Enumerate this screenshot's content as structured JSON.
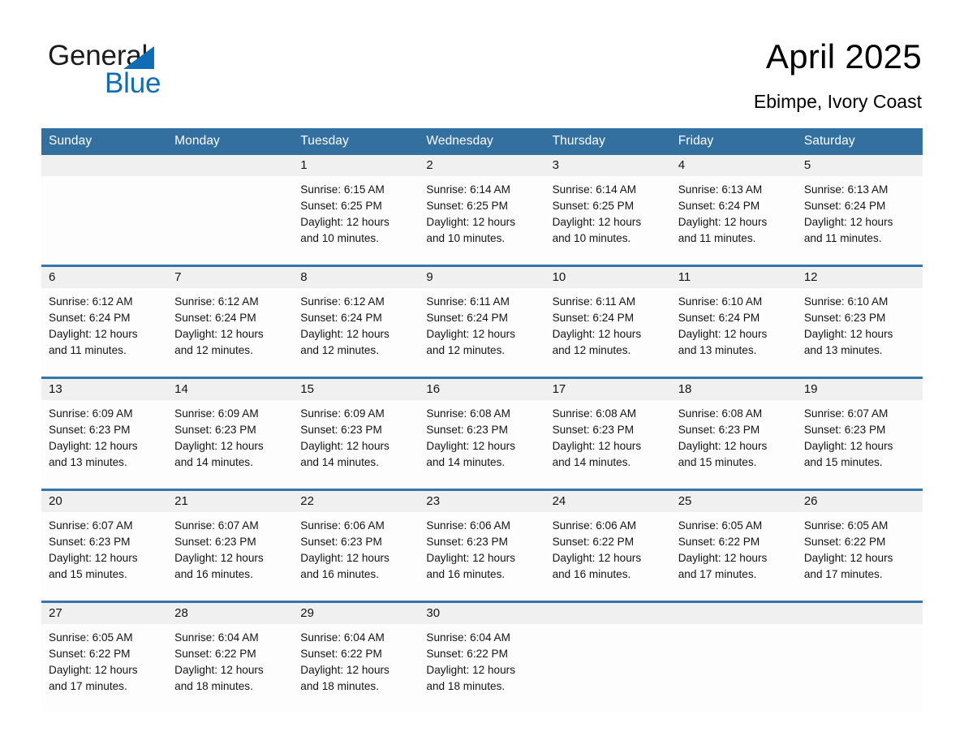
{
  "brand": {
    "name_part1": "General",
    "name_part2": "Blue",
    "triangle_color": "#0f6cb5"
  },
  "header": {
    "title": "April 2025",
    "location": "Ebimpe, Ivory Coast"
  },
  "theme": {
    "header_blue": "#33709f",
    "row_separator_blue": "#3575ad",
    "daynum_band_gray": "#f0f0f0",
    "cell_background": "#fdfdfd",
    "text_color": "#141414"
  },
  "weekday_headers": [
    "Sunday",
    "Monday",
    "Tuesday",
    "Wednesday",
    "Thursday",
    "Friday",
    "Saturday"
  ],
  "weeks": [
    [
      {
        "day": "",
        "empty": true,
        "sunrise": "",
        "sunset": "",
        "daylight_line1": "",
        "daylight_line2": ""
      },
      {
        "day": "",
        "empty": true,
        "sunrise": "",
        "sunset": "",
        "daylight_line1": "",
        "daylight_line2": ""
      },
      {
        "day": "1",
        "empty": false,
        "sunrise": "Sunrise: 6:15 AM",
        "sunset": "Sunset: 6:25 PM",
        "daylight_line1": "Daylight: 12 hours",
        "daylight_line2": "and 10 minutes."
      },
      {
        "day": "2",
        "empty": false,
        "sunrise": "Sunrise: 6:14 AM",
        "sunset": "Sunset: 6:25 PM",
        "daylight_line1": "Daylight: 12 hours",
        "daylight_line2": "and 10 minutes."
      },
      {
        "day": "3",
        "empty": false,
        "sunrise": "Sunrise: 6:14 AM",
        "sunset": "Sunset: 6:25 PM",
        "daylight_line1": "Daylight: 12 hours",
        "daylight_line2": "and 10 minutes."
      },
      {
        "day": "4",
        "empty": false,
        "sunrise": "Sunrise: 6:13 AM",
        "sunset": "Sunset: 6:24 PM",
        "daylight_line1": "Daylight: 12 hours",
        "daylight_line2": "and 11 minutes."
      },
      {
        "day": "5",
        "empty": false,
        "sunrise": "Sunrise: 6:13 AM",
        "sunset": "Sunset: 6:24 PM",
        "daylight_line1": "Daylight: 12 hours",
        "daylight_line2": "and 11 minutes."
      }
    ],
    [
      {
        "day": "6",
        "empty": false,
        "sunrise": "Sunrise: 6:12 AM",
        "sunset": "Sunset: 6:24 PM",
        "daylight_line1": "Daylight: 12 hours",
        "daylight_line2": "and 11 minutes."
      },
      {
        "day": "7",
        "empty": false,
        "sunrise": "Sunrise: 6:12 AM",
        "sunset": "Sunset: 6:24 PM",
        "daylight_line1": "Daylight: 12 hours",
        "daylight_line2": "and 12 minutes."
      },
      {
        "day": "8",
        "empty": false,
        "sunrise": "Sunrise: 6:12 AM",
        "sunset": "Sunset: 6:24 PM",
        "daylight_line1": "Daylight: 12 hours",
        "daylight_line2": "and 12 minutes."
      },
      {
        "day": "9",
        "empty": false,
        "sunrise": "Sunrise: 6:11 AM",
        "sunset": "Sunset: 6:24 PM",
        "daylight_line1": "Daylight: 12 hours",
        "daylight_line2": "and 12 minutes."
      },
      {
        "day": "10",
        "empty": false,
        "sunrise": "Sunrise: 6:11 AM",
        "sunset": "Sunset: 6:24 PM",
        "daylight_line1": "Daylight: 12 hours",
        "daylight_line2": "and 12 minutes."
      },
      {
        "day": "11",
        "empty": false,
        "sunrise": "Sunrise: 6:10 AM",
        "sunset": "Sunset: 6:24 PM",
        "daylight_line1": "Daylight: 12 hours",
        "daylight_line2": "and 13 minutes."
      },
      {
        "day": "12",
        "empty": false,
        "sunrise": "Sunrise: 6:10 AM",
        "sunset": "Sunset: 6:23 PM",
        "daylight_line1": "Daylight: 12 hours",
        "daylight_line2": "and 13 minutes."
      }
    ],
    [
      {
        "day": "13",
        "empty": false,
        "sunrise": "Sunrise: 6:09 AM",
        "sunset": "Sunset: 6:23 PM",
        "daylight_line1": "Daylight: 12 hours",
        "daylight_line2": "and 13 minutes."
      },
      {
        "day": "14",
        "empty": false,
        "sunrise": "Sunrise: 6:09 AM",
        "sunset": "Sunset: 6:23 PM",
        "daylight_line1": "Daylight: 12 hours",
        "daylight_line2": "and 14 minutes."
      },
      {
        "day": "15",
        "empty": false,
        "sunrise": "Sunrise: 6:09 AM",
        "sunset": "Sunset: 6:23 PM",
        "daylight_line1": "Daylight: 12 hours",
        "daylight_line2": "and 14 minutes."
      },
      {
        "day": "16",
        "empty": false,
        "sunrise": "Sunrise: 6:08 AM",
        "sunset": "Sunset: 6:23 PM",
        "daylight_line1": "Daylight: 12 hours",
        "daylight_line2": "and 14 minutes."
      },
      {
        "day": "17",
        "empty": false,
        "sunrise": "Sunrise: 6:08 AM",
        "sunset": "Sunset: 6:23 PM",
        "daylight_line1": "Daylight: 12 hours",
        "daylight_line2": "and 14 minutes."
      },
      {
        "day": "18",
        "empty": false,
        "sunrise": "Sunrise: 6:08 AM",
        "sunset": "Sunset: 6:23 PM",
        "daylight_line1": "Daylight: 12 hours",
        "daylight_line2": "and 15 minutes."
      },
      {
        "day": "19",
        "empty": false,
        "sunrise": "Sunrise: 6:07 AM",
        "sunset": "Sunset: 6:23 PM",
        "daylight_line1": "Daylight: 12 hours",
        "daylight_line2": "and 15 minutes."
      }
    ],
    [
      {
        "day": "20",
        "empty": false,
        "sunrise": "Sunrise: 6:07 AM",
        "sunset": "Sunset: 6:23 PM",
        "daylight_line1": "Daylight: 12 hours",
        "daylight_line2": "and 15 minutes."
      },
      {
        "day": "21",
        "empty": false,
        "sunrise": "Sunrise: 6:07 AM",
        "sunset": "Sunset: 6:23 PM",
        "daylight_line1": "Daylight: 12 hours",
        "daylight_line2": "and 16 minutes."
      },
      {
        "day": "22",
        "empty": false,
        "sunrise": "Sunrise: 6:06 AM",
        "sunset": "Sunset: 6:23 PM",
        "daylight_line1": "Daylight: 12 hours",
        "daylight_line2": "and 16 minutes."
      },
      {
        "day": "23",
        "empty": false,
        "sunrise": "Sunrise: 6:06 AM",
        "sunset": "Sunset: 6:23 PM",
        "daylight_line1": "Daylight: 12 hours",
        "daylight_line2": "and 16 minutes."
      },
      {
        "day": "24",
        "empty": false,
        "sunrise": "Sunrise: 6:06 AM",
        "sunset": "Sunset: 6:22 PM",
        "daylight_line1": "Daylight: 12 hours",
        "daylight_line2": "and 16 minutes."
      },
      {
        "day": "25",
        "empty": false,
        "sunrise": "Sunrise: 6:05 AM",
        "sunset": "Sunset: 6:22 PM",
        "daylight_line1": "Daylight: 12 hours",
        "daylight_line2": "and 17 minutes."
      },
      {
        "day": "26",
        "empty": false,
        "sunrise": "Sunrise: 6:05 AM",
        "sunset": "Sunset: 6:22 PM",
        "daylight_line1": "Daylight: 12 hours",
        "daylight_line2": "and 17 minutes."
      }
    ],
    [
      {
        "day": "27",
        "empty": false,
        "sunrise": "Sunrise: 6:05 AM",
        "sunset": "Sunset: 6:22 PM",
        "daylight_line1": "Daylight: 12 hours",
        "daylight_line2": "and 17 minutes."
      },
      {
        "day": "28",
        "empty": false,
        "sunrise": "Sunrise: 6:04 AM",
        "sunset": "Sunset: 6:22 PM",
        "daylight_line1": "Daylight: 12 hours",
        "daylight_line2": "and 18 minutes."
      },
      {
        "day": "29",
        "empty": false,
        "sunrise": "Sunrise: 6:04 AM",
        "sunset": "Sunset: 6:22 PM",
        "daylight_line1": "Daylight: 12 hours",
        "daylight_line2": "and 18 minutes."
      },
      {
        "day": "30",
        "empty": false,
        "sunrise": "Sunrise: 6:04 AM",
        "sunset": "Sunset: 6:22 PM",
        "daylight_line1": "Daylight: 12 hours",
        "daylight_line2": "and 18 minutes."
      },
      {
        "day": "",
        "empty": true,
        "sunrise": "",
        "sunset": "",
        "daylight_line1": "",
        "daylight_line2": ""
      },
      {
        "day": "",
        "empty": true,
        "sunrise": "",
        "sunset": "",
        "daylight_line1": "",
        "daylight_line2": ""
      },
      {
        "day": "",
        "empty": true,
        "sunrise": "",
        "sunset": "",
        "daylight_line1": "",
        "daylight_line2": ""
      }
    ]
  ]
}
